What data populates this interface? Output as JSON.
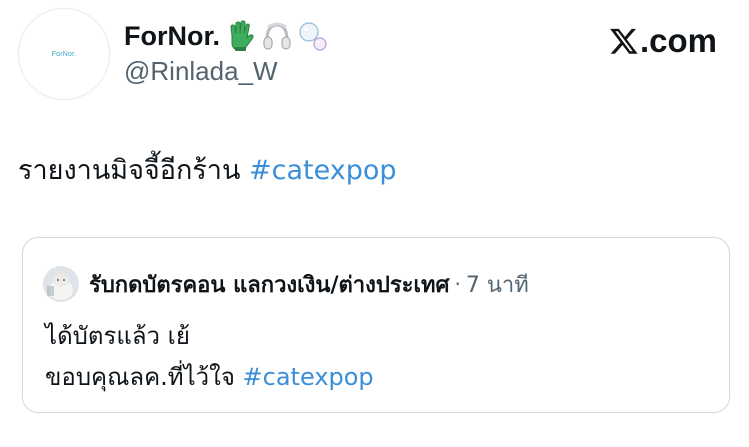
{
  "author": {
    "avatar_text": "ForNor.",
    "display_name": "ForNor.",
    "handle": "@Rinlada_W",
    "name_emojis": [
      "glove-icon",
      "headphones-icon",
      "bubbles-icon"
    ]
  },
  "brand": {
    "text": ".com",
    "logo_icon": "x-logo-icon"
  },
  "tweet": {
    "text": "รายงานมิจจี้อีกร้าน ",
    "hashtag": "#catexpop"
  },
  "quoted": {
    "display_name": "รับกดบัตรคอน แลกวงเงิน/ต่างประเทศ",
    "separator": "·",
    "time": "7 นาที",
    "line1": "ได้บัตรแล้ว เย้",
    "line2_text": "ขอบคุณลค.ที่ไว้ใจ ",
    "line2_hashtag": "#catexpop"
  },
  "colors": {
    "hashtag": "#3b8fd9",
    "border": "#cfd9de",
    "secondary_text": "#536471"
  }
}
